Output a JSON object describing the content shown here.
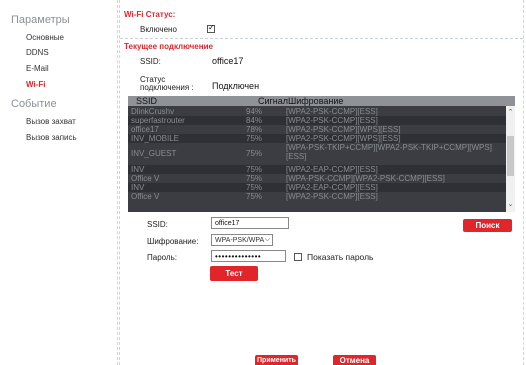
{
  "sidebar": {
    "parameters_heading": "Параметры",
    "parameters_items": [
      "Основные",
      "DDNS",
      "E-Mail",
      "Wi-Fi"
    ],
    "active_item": "Wi-Fi",
    "event_heading": "Событие",
    "event_items": [
      "Вызов захват",
      "Вызов запись"
    ]
  },
  "wifi_status": {
    "title": "Wi-Fi Статус:",
    "enabled_label": "Включено",
    "enabled": true
  },
  "current_connection": {
    "title": "Текущее подключение",
    "ssid_label": "SSID:",
    "ssid_value": "office17",
    "status_label_line1": "Статус",
    "status_label_line2": "подключения :",
    "status_value": "Подключен"
  },
  "network_table": {
    "headers": [
      "SSID",
      "Сигнал",
      "Шифрование"
    ],
    "rows": [
      {
        "ssid": "DlinkCrushv",
        "signal": "94%",
        "encryption": "[WPA2-PSK-CCMP][ESS]"
      },
      {
        "ssid": "superfastrouter",
        "signal": "84%",
        "encryption": "[WPA2-PSK-CCMP][ESS]"
      },
      {
        "ssid": "office17",
        "signal": "78%",
        "encryption": "[WPA2-PSK-CCMP][WPS][ESS]"
      },
      {
        "ssid": "INV_MOBILE",
        "signal": "75%",
        "encryption": "[WPA2-PSK-CCMP][WPS][ESS]"
      },
      {
        "ssid": "INV_GUEST",
        "signal": "75%",
        "encryption": "[WPA-PSK-TKIP+CCMP][WPA2-PSK-TKIP+CCMP][WPS][ESS]"
      },
      {
        "ssid": "INV",
        "signal": "75%",
        "encryption": "[WPA2-EAP-CCMP][ESS]"
      },
      {
        "ssid": "Office V",
        "signal": "75%",
        "encryption": "[WPA-PSK-CCMP][WPA2-PSK-CCMP][ESS]"
      },
      {
        "ssid": "INV",
        "signal": "75%",
        "encryption": "[WPA2-EAP-CCMP][ESS]"
      },
      {
        "ssid": "Office V",
        "signal": "75%",
        "encryption": "[WPA2-PSK-CCMP][ESS]"
      }
    ]
  },
  "form": {
    "ssid_label": "SSID:",
    "ssid_value": "office17",
    "encryption_label": "Шифрование:",
    "encryption_value": "WPA-PSK/WPA",
    "password_label": "Пароль:",
    "password_value": "••••••••••••••",
    "show_password_label": "Показать пароль",
    "show_password_checked": false,
    "search_button": "Поиск",
    "test_button": "Тест"
  },
  "footer": {
    "apply_button": "Применить",
    "cancel_button": "Отмена"
  },
  "colors": {
    "accent": "#e0262b",
    "table_bg": "#3b3d42",
    "table_header": "#8f9398"
  }
}
